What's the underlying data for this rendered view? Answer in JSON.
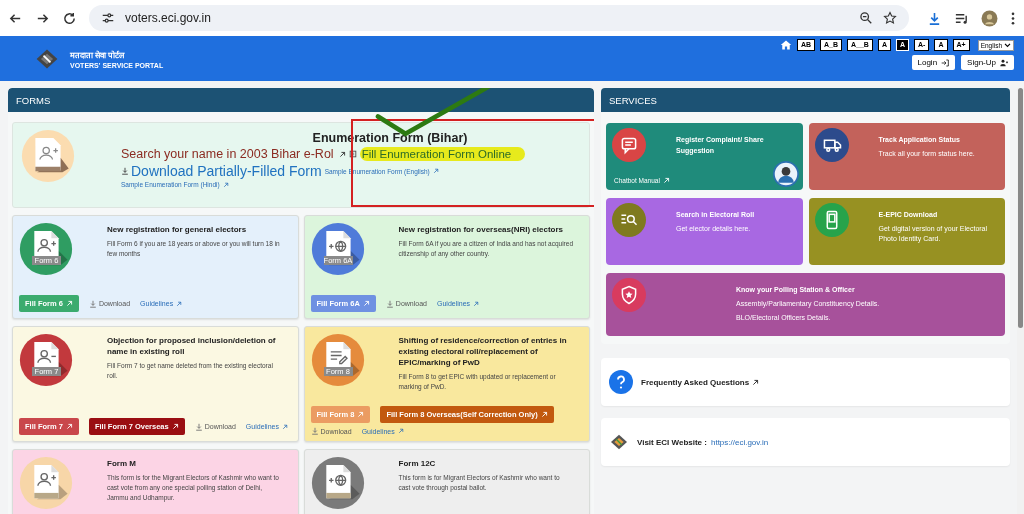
{
  "browser": {
    "url": "voters.eci.gov.in"
  },
  "header": {
    "title_hindi": "मतदाता सेवा पोर्टल",
    "title": "VOTERS' SERVICE PORTAL",
    "language": "English",
    "login": "Login",
    "signup": "Sign-Up",
    "a11y_buttons": [
      {
        "label": "AB",
        "dark": false
      },
      {
        "label": "A_B",
        "dark": false
      },
      {
        "label": "A__B",
        "dark": false
      },
      {
        "label": "A",
        "dark": false
      },
      {
        "label": "A",
        "dark": true
      },
      {
        "label": "A-",
        "dark": false
      },
      {
        "label": "A",
        "dark": false
      },
      {
        "label": "A+",
        "dark": false
      }
    ]
  },
  "forms": {
    "heading": "FORMS",
    "enumeration": {
      "title": "Enumeration Form (Bihar)",
      "search_link": "Search your name in 2003 Bihar e-Rol",
      "fill_link": "Fill Enumeration Form Online",
      "highlighted": true,
      "download_link": "Download Partially-Filled Form",
      "sample_english": "Sample Enumeration Form (English)",
      "sample_hindi": "Sample Enumeration Form (Hindi)"
    },
    "cards": [
      {
        "title": "New registration for general electors",
        "description": "Fill Form 6 if you are 18 years or above or you will turn 18 in few months",
        "icon_label": "Form 6",
        "color": "#2f9d62",
        "actions": [
          {
            "kind": "button",
            "label": "Fill Form 6",
            "color": "#3bab6e"
          },
          {
            "kind": "download",
            "label": "Download"
          },
          {
            "kind": "link",
            "label": "Guidelines"
          }
        ]
      },
      {
        "title": "New registration for overseas(NRI) electors",
        "description": "Fill Form 6A if you are a citizen of India and has not acquired citizenship of any other country.",
        "icon_label": "Form 6A",
        "color": "#4f7bd9",
        "actions": [
          {
            "kind": "button",
            "label": "Fill Form 6A",
            "color": "#6f91e2"
          },
          {
            "kind": "download",
            "label": "Download"
          },
          {
            "kind": "link",
            "label": "Guidelines"
          }
        ]
      },
      {
        "title": "Objection for proposed inclusion/deletion of name in existing roll",
        "description": "Fill Form 7 to get name deleted from the existing electoral roll.",
        "icon_label": "Form 7",
        "color": "#c2393d",
        "actions": [
          {
            "kind": "button",
            "label": "Fill Form 7",
            "color": "#c9474b"
          },
          {
            "kind": "button",
            "label": "Fill Form 7 Overseas",
            "color": "#9a0e12"
          },
          {
            "kind": "download",
            "label": "Download"
          },
          {
            "kind": "link",
            "label": "Guidelines"
          }
        ]
      },
      {
        "title": "Shifting of residence/correction of entries in existing electoral roll/replacement of EPIC/marking of PwD",
        "description": "Fill Form 8 to get EPIC with updated or replacement or marking of PwD.",
        "icon_label": "Form 8",
        "color": "#e58b3c",
        "actions": [
          {
            "kind": "button",
            "label": "Fill Form 8",
            "color": "#eb9c62"
          },
          {
            "kind": "button",
            "label": "Fill Form 8 Overseas(Self Correction Only)",
            "color": "#c2590f"
          },
          {
            "kind": "download",
            "label": "Download"
          },
          {
            "kind": "link",
            "label": "Guidelines"
          }
        ]
      },
      {
        "title": "Form M",
        "description": "This form is for the Migrant Electors of Kashmir who want to cast vote from any one special polling station of Delhi, Jammu and Udhampur.",
        "color": "#f7d6a8"
      },
      {
        "title": "Form 12C",
        "description": "This form is for Migrant Electors of Kashmir who want to cast vote through postal ballot.",
        "color": "#7a7a7a"
      }
    ]
  },
  "services": {
    "heading": "SERVICES",
    "tiles": [
      {
        "title": "Register Complaint/ Share Suggestion",
        "link": "Chatbot Manual",
        "avatar": true,
        "color": "#1f8b7b",
        "wide": false
      },
      {
        "title": "Track Application Status",
        "lines": [
          "Track all your form status here."
        ],
        "avatar": false,
        "color": "#c3625b",
        "wide": false
      },
      {
        "title": "Search in Electoral Roll",
        "lines": [
          "Get elector details here."
        ],
        "avatar": false,
        "color": "#a868e2",
        "wide": false
      },
      {
        "title": "E-EPIC Download",
        "lines": [
          "Get digital version of your Electoral Photo Identity Card."
        ],
        "avatar": false,
        "color": "#979122",
        "wide": false
      },
      {
        "title": "Know your Polling Station & Officer",
        "lines": [
          "Assembly/Parliamentary Constituency Details.",
          "BLO/Electoral Officers Details."
        ],
        "avatar": false,
        "color": "#a7519b",
        "wide": true
      }
    ]
  },
  "faq": "Frequently Asked Questions",
  "website": {
    "label": "Visit ECI Website :",
    "url": "https://eci.gov.in"
  }
}
